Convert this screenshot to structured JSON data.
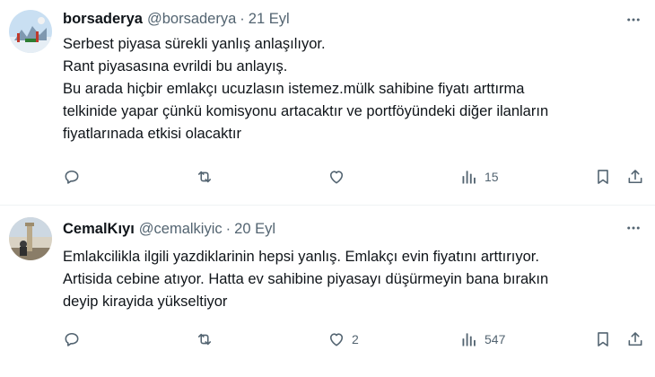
{
  "tweets": [
    {
      "name": "borsaderya",
      "handle": "@borsaderya",
      "separator": "·",
      "date": "21 Eyl",
      "lines": [
        "Serbest piyasa sürekli yanlış anlaşılıyor.",
        "Rant piyasasına evrildi bu anlayış.",
        "Bu arada hiçbir emlakçı ucuzlasın istemez.mülk sahibine fiyatı arttırma",
        "telkinide yapar çünkü komisyonu artacaktır ve portföyündeki diğer ilanların",
        "fiyatlarınada etkisi olacaktır"
      ],
      "actions": {
        "replies": "",
        "reposts": "",
        "likes": "",
        "views": "15"
      },
      "colors": {
        "avatar_bg": "#c9dff2"
      }
    },
    {
      "name": "CemalKıyı",
      "handle": "@cemalkiyic",
      "separator": "·",
      "date": "20 Eyl",
      "lines": [
        "Emlakcilikla ilgili yazdiklarinin hepsi yanlış. Emlakçı evin fiyatını arttırıyor.",
        "Artisida cebine atıyor. Hatta ev sahibine piyasayı düşürmeyin bana bırakın",
        "deyip kirayida yükseltiyor"
      ],
      "actions": {
        "replies": "",
        "reposts": "",
        "likes": "2",
        "views": "547"
      },
      "colors": {
        "avatar_bg": "#d9d2c3"
      }
    }
  ],
  "colors": {
    "text": "#0f1419",
    "secondary": "#536471",
    "divider": "#eff3f4"
  }
}
